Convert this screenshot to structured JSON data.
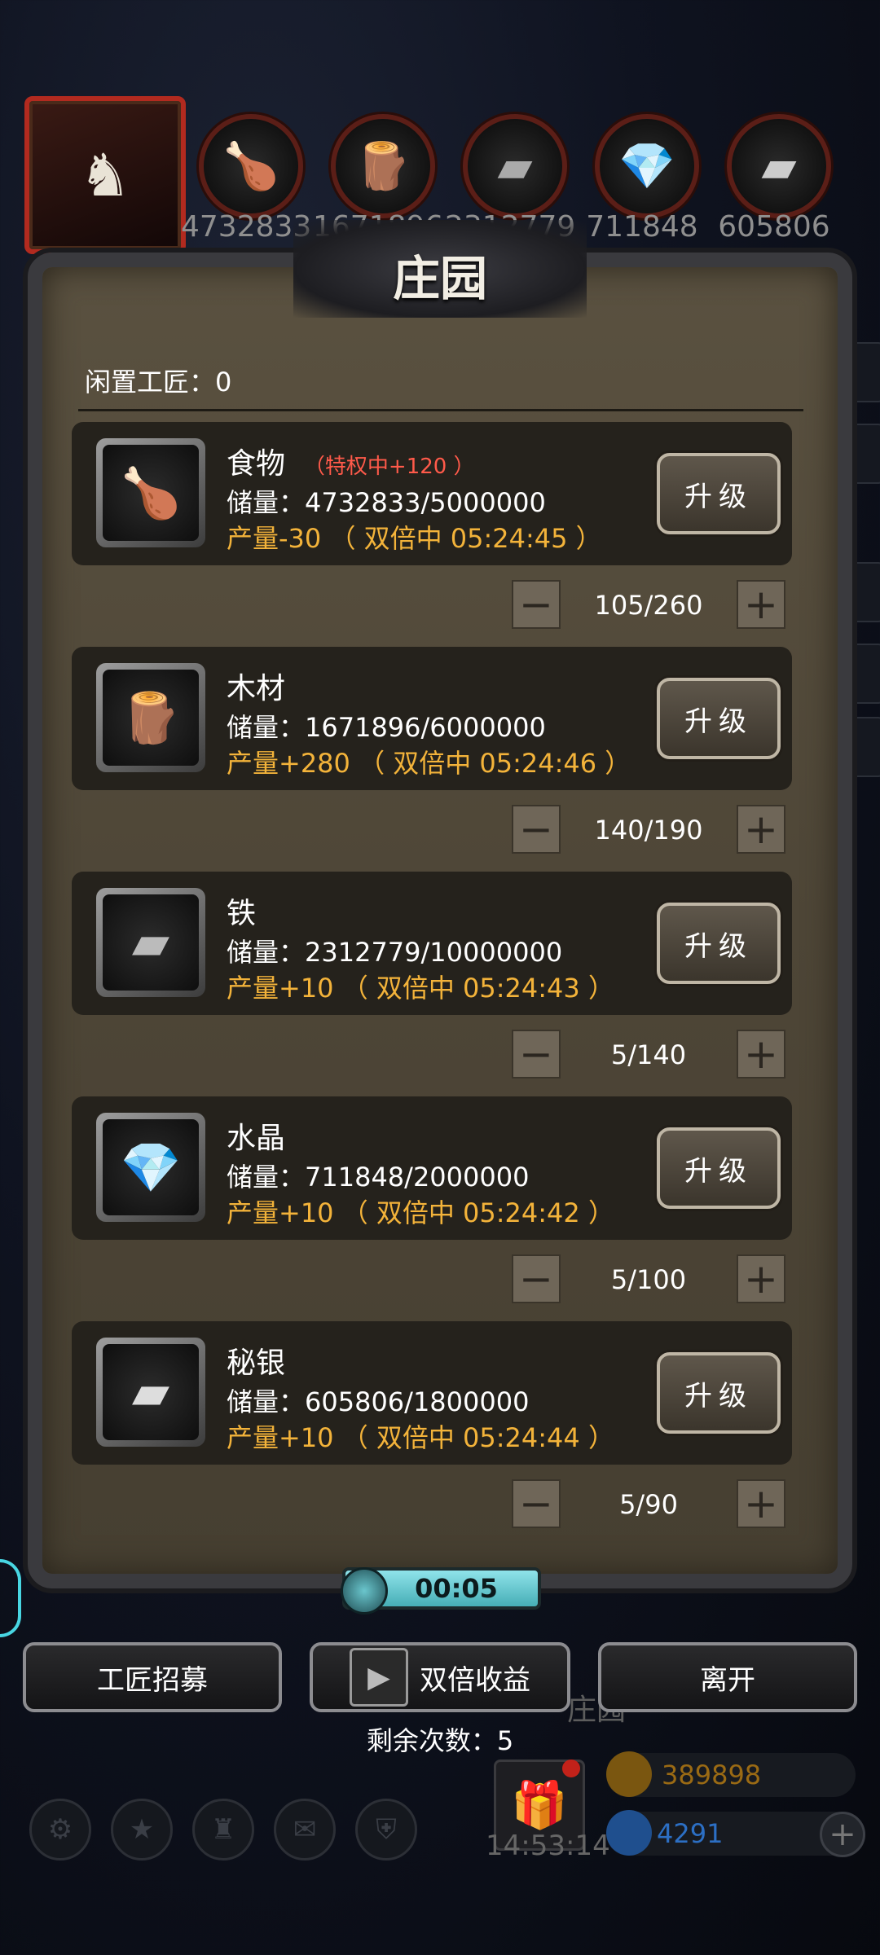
{
  "top_bar": {
    "avatar_glyph": "♞",
    "resources": [
      {
        "icon": "food-icon",
        "glyph": "🍗",
        "value": "4732833"
      },
      {
        "icon": "wood-icon",
        "glyph": "🪵",
        "value": "1671896"
      },
      {
        "icon": "iron-icon",
        "glyph": "▰",
        "value": "2312779"
      },
      {
        "icon": "crystal-icon",
        "glyph": "💎",
        "value": "711848"
      },
      {
        "icon": "mithril-icon",
        "glyph": "▰",
        "value": "605806"
      }
    ]
  },
  "panel": {
    "title": "庄园",
    "idle_label": "闲置工匠：0",
    "upgrade_label": "升级",
    "items": [
      {
        "name": "食物",
        "bonus": "（特权中+120 ）",
        "storage": "储量：4732833/5000000",
        "production": "产量-30 （ 双倍中 05:24:45 ）",
        "workers": "105/260",
        "glyph": "🍗"
      },
      {
        "name": "木材",
        "bonus": "",
        "storage": "储量：1671896/6000000",
        "production": "产量+280 （ 双倍中 05:24:46 ）",
        "workers": "140/190",
        "glyph": "🪵"
      },
      {
        "name": "铁",
        "bonus": "",
        "storage": "储量：2312779/10000000",
        "production": "产量+10 （ 双倍中 05:24:43 ）",
        "workers": "5/140",
        "glyph": "▰"
      },
      {
        "name": "水晶",
        "bonus": "",
        "storage": "储量：711848/2000000",
        "production": "产量+10 （ 双倍中 05:24:42 ）",
        "workers": "5/100",
        "glyph": "💎"
      },
      {
        "name": "秘银",
        "bonus": "",
        "storage": "储量：605806/1800000",
        "production": "产量+10 （ 双倍中 05:24:44 ）",
        "workers": "5/90",
        "glyph": "▰"
      }
    ],
    "minus_glyph": "−",
    "plus_glyph": "+",
    "timer": "00:05"
  },
  "actions": {
    "recruit": "工匠招募",
    "double": "双倍收益",
    "leave": "离开",
    "remaining": "剩余次数：5",
    "play_glyph": "▶"
  },
  "background": {
    "label": "庄园",
    "clock": "14:53:14",
    "gold": "389898",
    "gems": "4291",
    "gold_color": "#9a6a14",
    "gem_color": "#2c6fc4"
  }
}
